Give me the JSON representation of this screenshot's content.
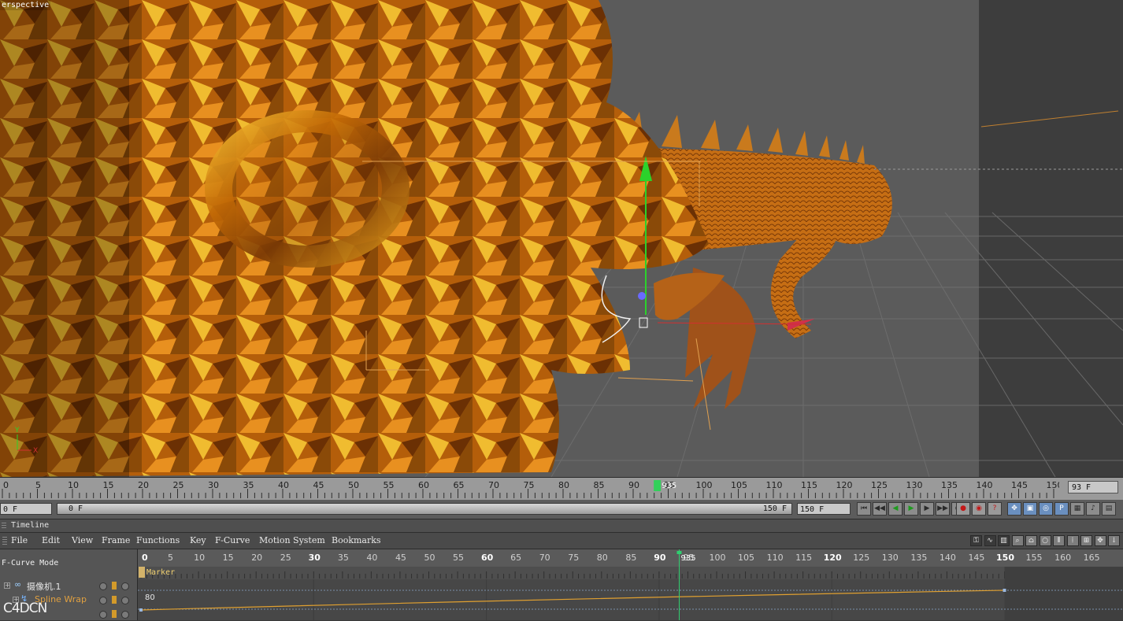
{
  "viewport": {
    "label": "erspective",
    "axis_labels": {
      "y": "Y",
      "x": "X"
    }
  },
  "ruler": {
    "ticks": [
      0,
      5,
      10,
      15,
      20,
      25,
      30,
      35,
      40,
      45,
      50,
      55,
      60,
      65,
      70,
      75,
      80,
      85,
      90,
      95,
      100,
      105,
      110,
      115,
      120,
      125,
      130,
      135,
      140,
      145,
      150
    ],
    "current_frame_label": "935",
    "current_frame_value": 93.5,
    "frame_field": "93 F"
  },
  "transport": {
    "start_field": "0 F",
    "slider_left": "0 F",
    "slider_right": "150 F",
    "end_field": "150 F",
    "buttons": [
      {
        "name": "go-to-start-icon",
        "glyph": "⏮"
      },
      {
        "name": "prev-key-icon",
        "glyph": "◀◀"
      },
      {
        "name": "step-back-icon",
        "glyph": "◀"
      },
      {
        "name": "play-icon",
        "glyph": "▶"
      },
      {
        "name": "step-forward-icon",
        "glyph": "▶"
      },
      {
        "name": "next-key-icon",
        "glyph": "▶▶"
      },
      {
        "name": "go-to-end-icon",
        "glyph": "⏭"
      }
    ],
    "record_buttons": [
      {
        "name": "record-keys-icon",
        "glyph": "●"
      },
      {
        "name": "autokey-icon",
        "glyph": "◉"
      },
      {
        "name": "keyframe-selection-icon",
        "glyph": "?"
      }
    ],
    "mode_buttons": [
      {
        "name": "move-icon",
        "glyph": "✥"
      },
      {
        "name": "scale-icon",
        "glyph": "▣"
      },
      {
        "name": "rotate-icon",
        "glyph": "◎"
      },
      {
        "name": "param-icon",
        "glyph": "P"
      },
      {
        "name": "grid-icon",
        "glyph": "▦"
      },
      {
        "name": "speaker-icon",
        "glyph": "♪"
      },
      {
        "name": "doc-icon",
        "glyph": "▤"
      }
    ]
  },
  "timeline": {
    "title": "Timeline",
    "menu": [
      "File",
      "Edit",
      "View",
      "Frame",
      "Functions",
      "Key",
      "F-Curve",
      "Motion System",
      "Bookmarks"
    ],
    "mode": "F-Curve Mode",
    "ticks": [
      0,
      5,
      10,
      15,
      20,
      25,
      30,
      35,
      40,
      45,
      50,
      55,
      60,
      65,
      70,
      75,
      80,
      85,
      90,
      95,
      100,
      105,
      110,
      115,
      120,
      125,
      130,
      135,
      140,
      145,
      150,
      155,
      160,
      165
    ],
    "current_frame_label": "935",
    "current_frame_value": 93.5,
    "marker": "Marker",
    "value_label": "80",
    "tracks": [
      {
        "name": "摄像机.1"
      },
      {
        "name": "Spline Wrap"
      }
    ],
    "watermark": "C4DCN",
    "tool_icons": [
      "key-icon",
      "fcurve-icon",
      "dopesheet-icon",
      "zoom-icon",
      "home-icon",
      "ellipse-icon",
      "bracket-icon",
      "dots-icon",
      "add-icon",
      "move-view-icon",
      "down-icon"
    ]
  }
}
